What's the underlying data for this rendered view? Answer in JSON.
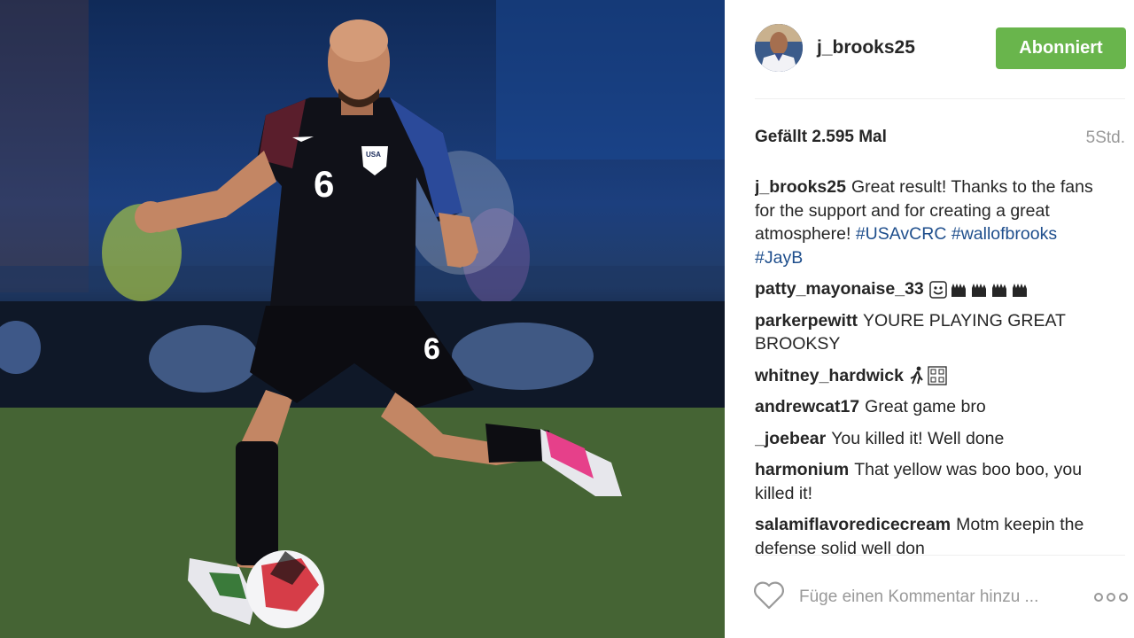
{
  "post": {
    "username": "j_brooks25",
    "follow_label": "Abonniert",
    "likes_text": "Gefällt 2.595 Mal",
    "time_text": "5Std.",
    "caption": {
      "user": "j_brooks25",
      "text": "Great result! Thanks to the fans for the support and for creating a great atmosphere!",
      "tags": [
        "#USAvCRC",
        "#wallofbrooks",
        "#JayB"
      ]
    },
    "comments": [
      {
        "user": "patty_mayonaise_33",
        "text": "",
        "emoji": [
          "face-icon",
          "hands-icon",
          "hands-icon",
          "hands-icon",
          "hands-icon"
        ]
      },
      {
        "user": "parkerpewitt",
        "text": "YOURE PLAYING GREAT BROOKSY"
      },
      {
        "user": "whitney_hardwick",
        "text": "",
        "emoji": [
          "runner-icon",
          "unknown-glyph-icon"
        ]
      },
      {
        "user": "andrewcat17",
        "text": "Great game bro"
      },
      {
        "user": "_joebear",
        "text": "You killed it! Well done"
      },
      {
        "user": "harmonium",
        "text": "That yellow was boo boo, you killed it!"
      },
      {
        "user": "salamiflavoredicecream",
        "text": "Motm keepin the defense solid well don"
      }
    ],
    "comment_placeholder": "Füge einen Kommentar hinzu ...",
    "jersey_number": "6",
    "crest_text": "USA"
  },
  "colors": {
    "follow_green": "#69b54c",
    "hashtag_blue": "#1e4e8c",
    "text_dark": "#262626",
    "muted_gray": "#999999"
  }
}
